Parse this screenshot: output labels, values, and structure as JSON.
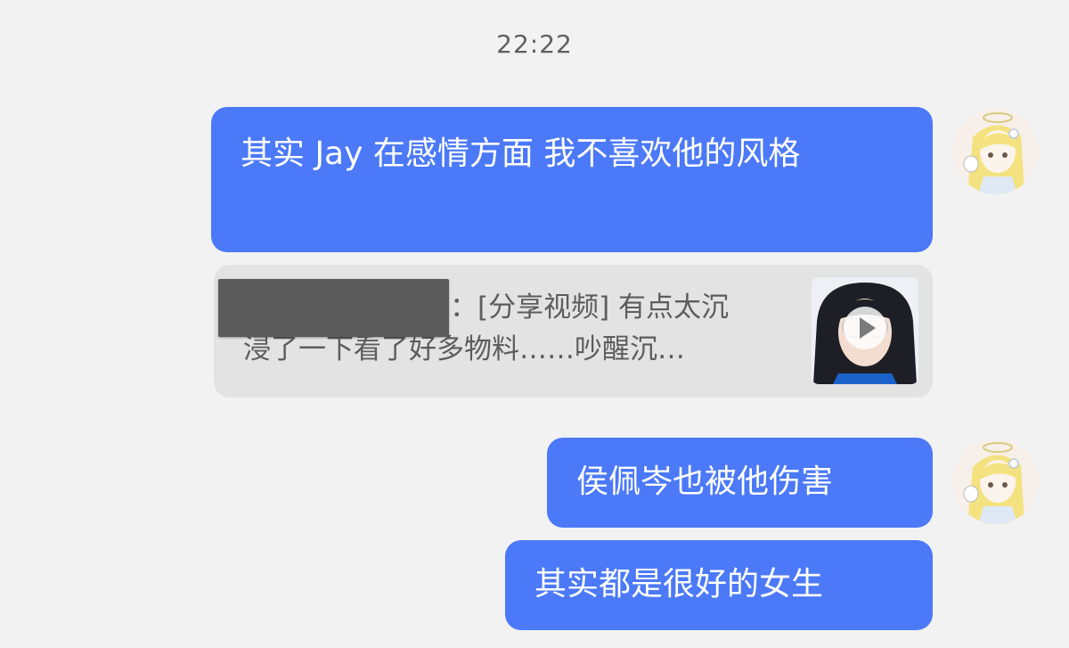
{
  "chat": {
    "timestamp": "22:22",
    "messages": [
      {
        "text": "其实 Jay 在感情方面 我不喜欢他的风格"
      },
      {
        "text": "侯佩岑也被他伤害"
      },
      {
        "text": "其实都是很好的女生"
      }
    ],
    "quote": {
      "line1": "：[分享视频] 有点太沉",
      "line2": "浸了一下看了好多物料……吵醒沉…"
    }
  },
  "colors": {
    "background": "#f2f2f2",
    "bubble": "#4b79f7",
    "quote_bg": "#e3e3e3",
    "timestamp_text": "#5f5f5f"
  },
  "icons": {
    "thumbnail": "video-thumbnail",
    "play": "play-icon",
    "avatar": "anime-girl-avatar"
  }
}
